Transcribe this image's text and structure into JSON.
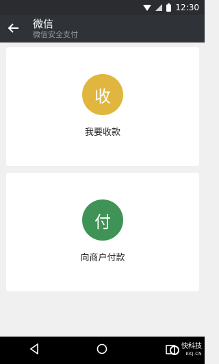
{
  "status_bar": {
    "time": "12:30",
    "icons": [
      "wifi-icon",
      "signal-icon",
      "battery-icon"
    ]
  },
  "app_bar": {
    "title": "微信",
    "subtitle": "微信安全支付",
    "back_icon": "arrow-left-icon"
  },
  "cards": {
    "receive": {
      "glyph": "收",
      "label": "我要收款",
      "color": "#e0b63e"
    },
    "pay": {
      "glyph": "付",
      "label": "向商户付款",
      "color": "#3f9357"
    }
  },
  "nav_bar": {
    "buttons": [
      "back-triangle-icon",
      "home-circle-icon",
      "recents-square-icon"
    ]
  },
  "watermark": {
    "text": "快科技",
    "sub": "KKJ.CN"
  }
}
